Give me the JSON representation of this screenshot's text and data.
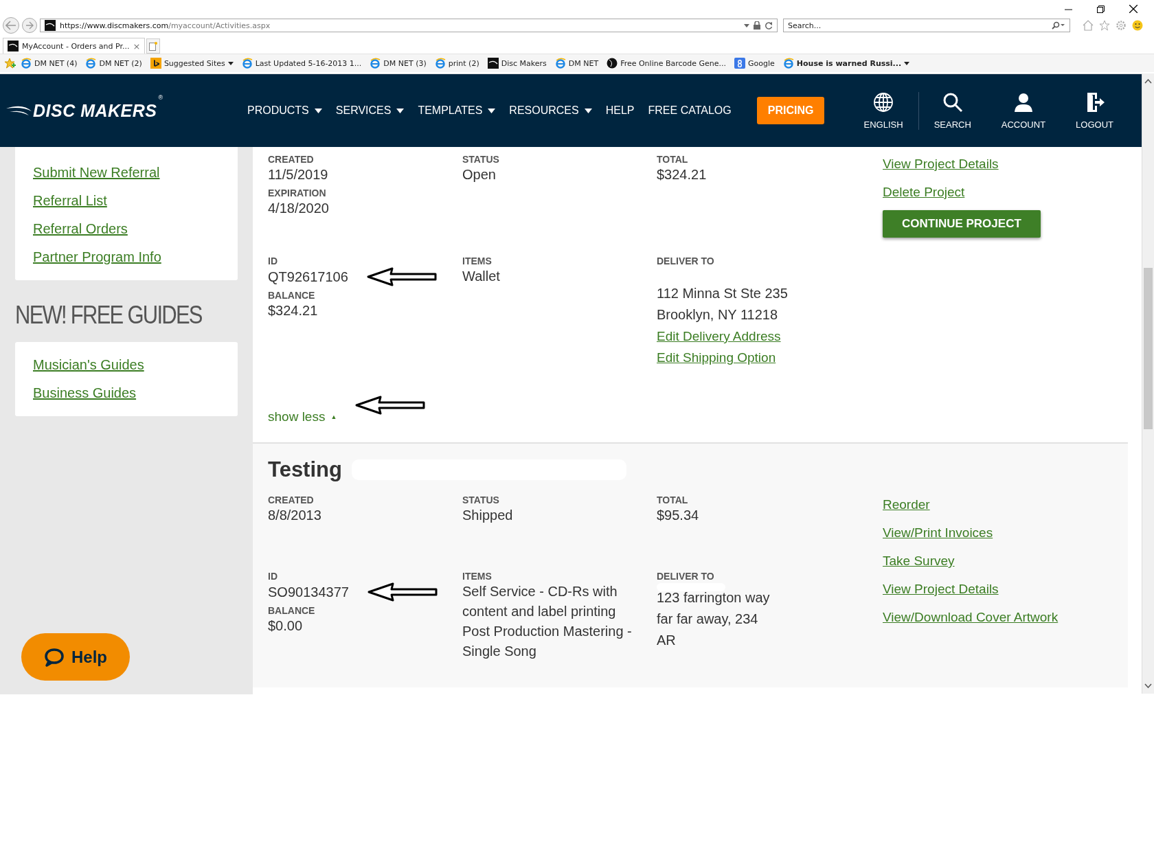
{
  "browser": {
    "url_host": "https://www.discmakers.com",
    "url_path": "/myaccount/Activities.aspx",
    "search_placeholder": "Search...",
    "tab_title": "MyAccount - Orders and Pr...",
    "tab_close": "×",
    "favorites": [
      {
        "label": "DM NET (4)",
        "kind": "ie",
        "bold": false,
        "caret": false
      },
      {
        "label": "DM NET (2)",
        "kind": "ie",
        "bold": false,
        "caret": false
      },
      {
        "label": "Suggested Sites",
        "kind": "bing",
        "bold": false,
        "caret": true
      },
      {
        "label": "Last Updated 5-16-2013 1...",
        "kind": "ie",
        "bold": false,
        "caret": false
      },
      {
        "label": "DM NET (3)",
        "kind": "ie",
        "bold": false,
        "caret": false
      },
      {
        "label": "print (2)",
        "kind": "ie",
        "bold": false,
        "caret": false
      },
      {
        "label": "Disc Makers",
        "kind": "site",
        "bold": false,
        "caret": false
      },
      {
        "label": "DM NET",
        "kind": "ie",
        "bold": false,
        "caret": false
      },
      {
        "label": "Free Online Barcode Gene...",
        "kind": "disc",
        "bold": false,
        "caret": false
      },
      {
        "label": "Google",
        "kind": "google",
        "bold": false,
        "caret": false
      },
      {
        "label": "House is warned Russi...",
        "kind": "ie",
        "bold": true,
        "caret": true
      }
    ]
  },
  "header": {
    "logo": "DISC MAKERS",
    "logo_mark": "®",
    "nav": [
      {
        "label": "PRODUCTS",
        "caret": true
      },
      {
        "label": "SERVICES",
        "caret": true
      },
      {
        "label": "TEMPLATES",
        "caret": true
      },
      {
        "label": "RESOURCES",
        "caret": true
      },
      {
        "label": "HELP",
        "caret": false
      },
      {
        "label": "FREE CATALOG",
        "caret": false
      }
    ],
    "pricing": "PRICING",
    "utilities": [
      {
        "label": "ENGLISH",
        "kind": "globe"
      },
      {
        "label": "SEARCH",
        "kind": "search"
      },
      {
        "label": "ACCOUNT",
        "kind": "person"
      },
      {
        "label": "LOGOUT",
        "kind": "logout"
      }
    ]
  },
  "sidebar": {
    "links": [
      "Submit New Referral",
      "Referral List",
      "Referral Orders",
      "Partner Program Info"
    ],
    "guides_heading": "NEW! FREE GUIDES",
    "guides": [
      "Musician's Guides",
      "Business Guides"
    ]
  },
  "orders": [
    {
      "labels": {
        "created": "CREATED",
        "expiration": "EXPIRATION",
        "status": "STATUS",
        "total": "TOTAL",
        "id": "ID",
        "balance": "BALANCE",
        "items": "ITEMS",
        "deliver_to": "DELIVER TO"
      },
      "created": "11/5/2019",
      "expiration": "4/18/2020",
      "status": "Open",
      "total": "$324.21",
      "id": "QT92617106",
      "balance": "$324.21",
      "items": [
        "Wallet"
      ],
      "deliver_to_redacted": false,
      "deliver_to": [
        "112 Minna St Ste 235",
        "Brooklyn, NY 11218"
      ],
      "address_links": [
        "Edit Delivery Address",
        "Edit Shipping Option"
      ],
      "actions": [
        "View Project Details",
        "Delete Project"
      ],
      "button": "CONTINUE PROJECT",
      "toggle": "show less",
      "toggle_icon": "▲"
    },
    {
      "title": "Testing",
      "labels": {
        "created": "CREATED",
        "status": "STATUS",
        "total": "TOTAL",
        "id": "ID",
        "balance": "BALANCE",
        "items": "ITEMS",
        "deliver_to": "DELIVER TO"
      },
      "created": "8/8/2013",
      "status": "Shipped",
      "total": "$95.34",
      "id": "SO90134377",
      "balance": "$0.00",
      "items": [
        "Self Service - CD-Rs with content and label printing",
        "Post Production Mastering - Single Song"
      ],
      "deliver_to_redacted": true,
      "deliver_to": [
        "123 farrington way",
        "far far away, 234",
        "AR"
      ],
      "actions": [
        "Reorder",
        "View/Print Invoices",
        "Take Survey",
        "View Project Details",
        "View/Download Cover Artwork"
      ]
    }
  ],
  "help_button": "Help"
}
